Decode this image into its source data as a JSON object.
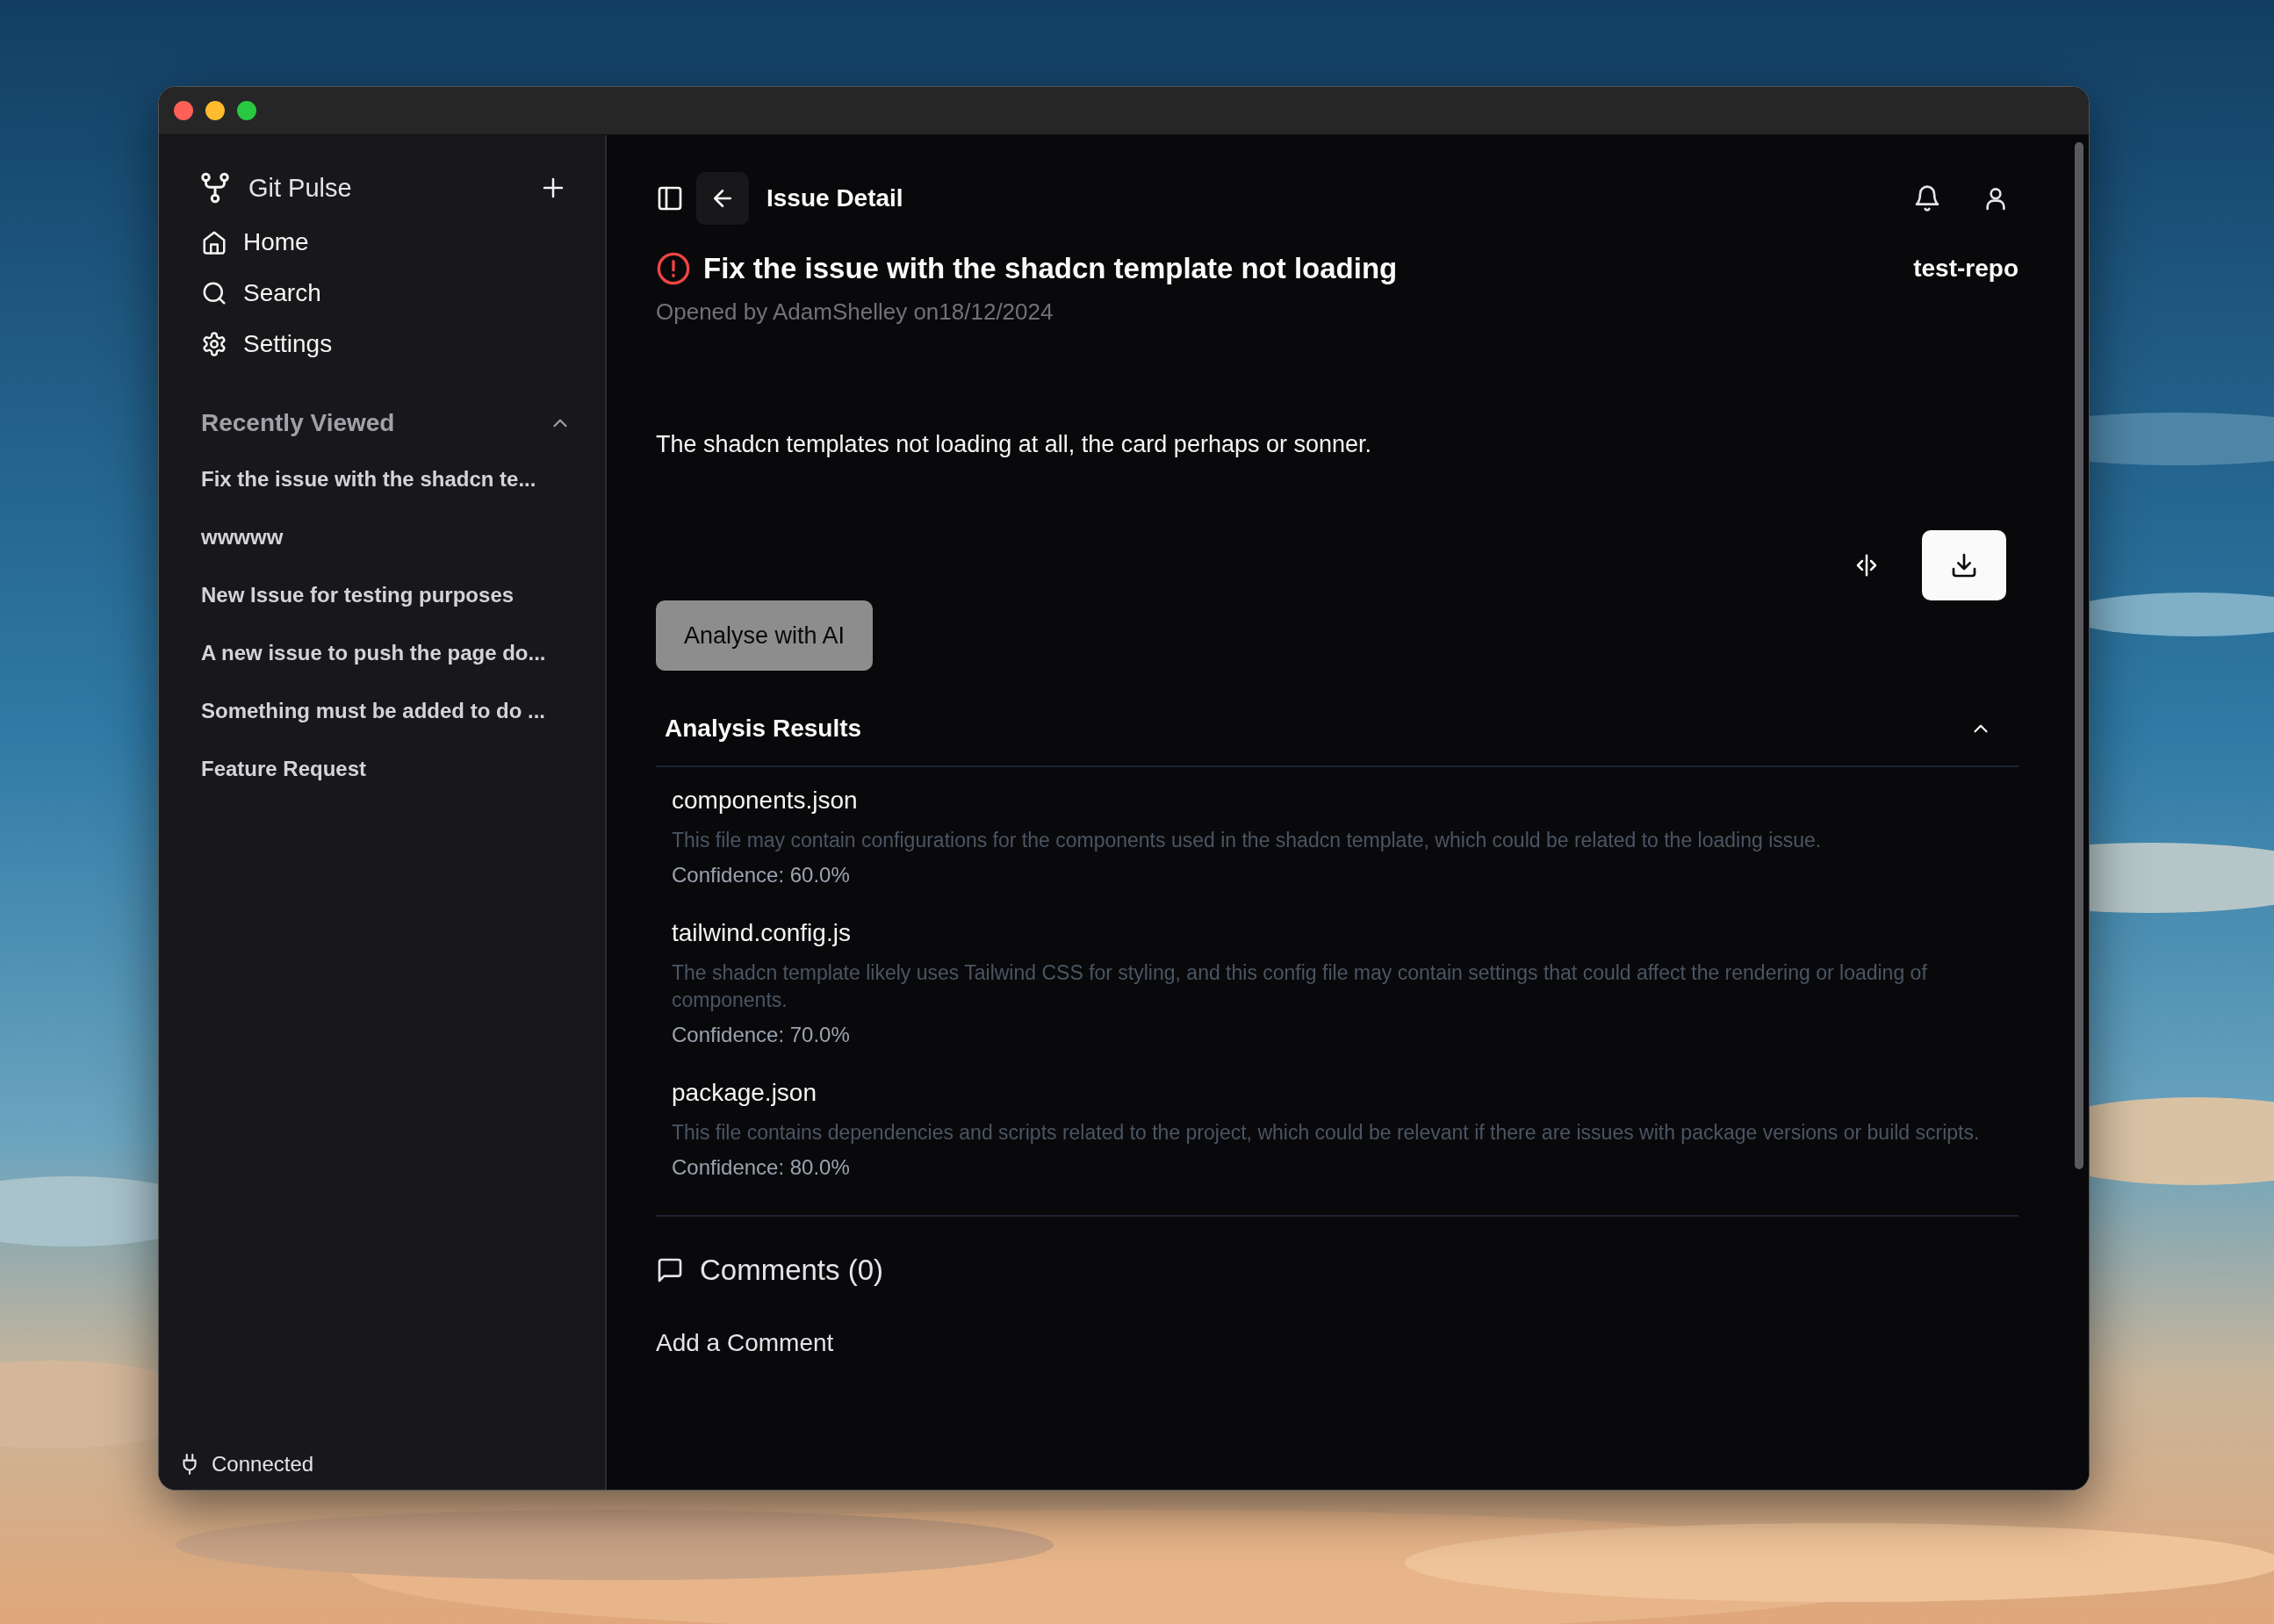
{
  "sidebar": {
    "app_name": "Git Pulse",
    "nav": [
      {
        "kind": "home",
        "label": "Home"
      },
      {
        "kind": "search",
        "label": "Search"
      },
      {
        "kind": "settings",
        "label": "Settings"
      }
    ],
    "recently_viewed": {
      "title": "Recently Viewed",
      "expanded": true,
      "items": [
        "Fix the issue with the shadcn te...",
        "wwwww",
        "New Issue for testing purposes",
        "A new issue to push the page do...",
        "Something must be added to do ...",
        "Feature Request"
      ]
    },
    "status": "Connected"
  },
  "header": {
    "title": "Issue Detail"
  },
  "issue": {
    "title": "Fix the issue with the shadcn template not loading",
    "repo": "test-repo",
    "meta": "Opened by AdamShelley on18/12/2024",
    "description": "The shadcn templates not loading at all, the card perhaps or sonner."
  },
  "analyse_button": {
    "label": "Analyse with AI",
    "disabled": true
  },
  "analysis": {
    "title": "Analysis Results",
    "expanded": true,
    "results": [
      {
        "file": "components.json",
        "reason": "This file may contain configurations for the components used in the shadcn template, which could be related to the loading issue.",
        "confidence": "Confidence: 60.0%"
      },
      {
        "file": "tailwind.config.js",
        "reason": "The shadcn template likely uses Tailwind CSS for styling, and this config file may contain settings that could affect the rendering or loading of components.",
        "confidence": "Confidence: 70.0%"
      },
      {
        "file": "package.json",
        "reason": "This file contains dependencies and scripts related to the project, which could be relevant if there are issues with package versions or build scripts.",
        "confidence": "Confidence: 80.0%"
      }
    ]
  },
  "comments": {
    "title": "Comments (0)",
    "add_label": "Add a Comment"
  }
}
